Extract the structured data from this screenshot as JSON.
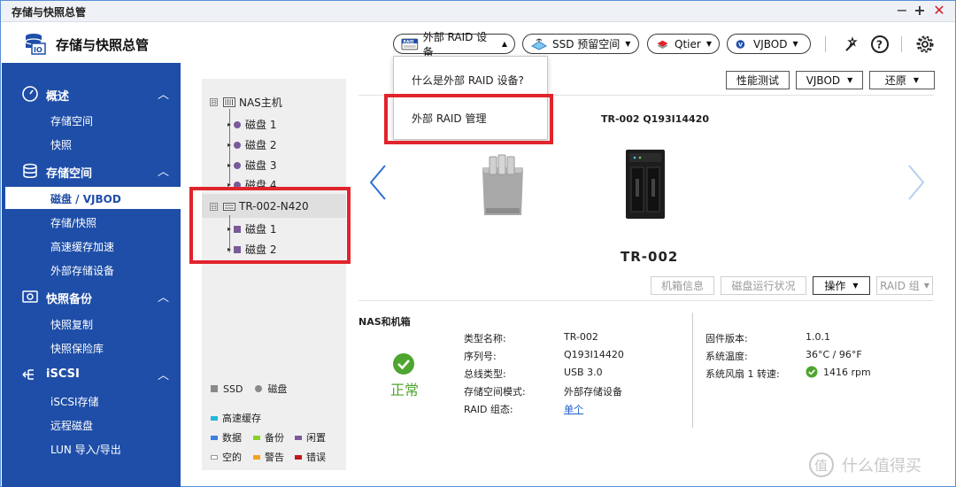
{
  "window": {
    "title": "存储与快照总管",
    "controls": {
      "minimize": "−",
      "maximize": "+",
      "close": "✕"
    }
  },
  "header": {
    "app_title": "存储与快照总管",
    "buttons": {
      "external_raid": {
        "badge": "RAID",
        "label": "外部 RAID 设备"
      },
      "ssd": {
        "label": "SSD 预留空间"
      },
      "qtier": {
        "label": "Qtier"
      },
      "vjbod": {
        "label": "VJBOD"
      }
    },
    "icons": [
      "wand-icon",
      "help-icon",
      "gear-icon"
    ]
  },
  "dropdown": {
    "items": [
      "什么是外部 RAID 设备?",
      "外部 RAID 管理"
    ]
  },
  "sidebar": {
    "sections": [
      {
        "label": "概述",
        "items": [
          "存储空间",
          "快照"
        ]
      },
      {
        "label": "存储空间",
        "items": [
          "磁盘 / VJBOD",
          "存储/快照",
          "高速缓存加速",
          "外部存储设备"
        ]
      },
      {
        "label": "快照备份",
        "items": [
          "快照复制",
          "快照保险库"
        ]
      },
      {
        "label": "iSCSI",
        "items": [
          "iSCSI存储",
          "远程磁盘",
          "LUN 导入/导出"
        ]
      }
    ]
  },
  "tree": {
    "nas_label": "NAS主机",
    "nas_disks": [
      "磁盘 1",
      "磁盘 2",
      "磁盘 3",
      "磁盘 4"
    ],
    "ext_label": "TR-002-N420",
    "ext_disks": [
      "磁盘 1",
      "磁盘 2"
    ],
    "toggle": "⊟"
  },
  "legend": {
    "types": [
      "SSD",
      "磁盘"
    ],
    "cache": "高速缓存",
    "items": [
      "数据",
      "备份",
      "闲置",
      "空的",
      "警告",
      "错误"
    ],
    "colors": {
      "cache": "#20b8d8",
      "data": "#3d7fe0",
      "backup": "#8ad02a",
      "idle": "#7a5a9a",
      "empty": "#ffffff",
      "warning": "#f5a020",
      "error": "#c0181c"
    }
  },
  "toolbar": {
    "perf_test": "性能测试",
    "vjbod": "VJBOD",
    "restore": "还原"
  },
  "device": {
    "header": "TR-002 Q193I14420",
    "name": "TR-002",
    "buttons": {
      "enclosure_info": "机箱信息",
      "disk_status": "磁盘运行状况",
      "action": "操作",
      "raid_group": "RAID 组"
    }
  },
  "info": {
    "section_title": "NAS和机箱",
    "status": "正常",
    "left": [
      {
        "k": "类型名称:",
        "v": "TR-002"
      },
      {
        "k": "序列号:",
        "v": "Q193I14420"
      },
      {
        "k": "总线类型:",
        "v": "USB 3.0"
      },
      {
        "k": "存储空间模式:",
        "v": "外部存储设备"
      },
      {
        "k": "RAID 组态:",
        "v": "单个"
      }
    ],
    "right": [
      {
        "k": "固件版本:",
        "v": "1.0.1"
      },
      {
        "k": "系统温度:",
        "v": "36°C / 96°F"
      },
      {
        "k": "系统风扇 1 转速:",
        "v": "1416 rpm"
      }
    ]
  },
  "watermark": {
    "text": "什么值得买",
    "glyph": "值"
  },
  "colors": {
    "sidebar": "#1e4ea8",
    "highlight": "#e0242c",
    "ok": "#4ea52f"
  }
}
